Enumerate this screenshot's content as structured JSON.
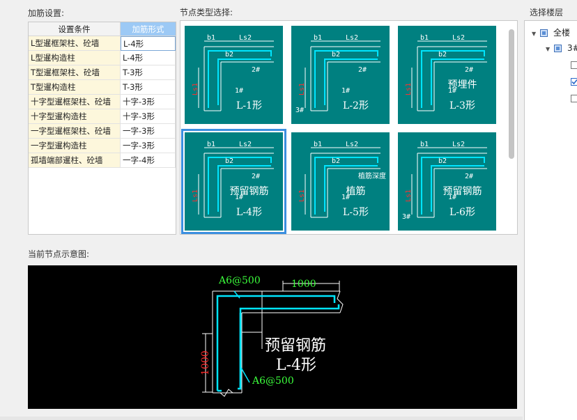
{
  "labels": {
    "rebar_settings": "加筋设置:",
    "node_type_select": "节点类型选择:",
    "current_node": "当前节点示意图:",
    "select_floor": "选择楼层"
  },
  "table": {
    "headers": [
      "设置条件",
      "加筋形式"
    ],
    "rows": [
      [
        "L型暹框架柱、砼墙",
        "L-4形"
      ],
      [
        "L型暹构造柱",
        "L-4形"
      ],
      [
        "T型暹框架柱、砼墙",
        "T-3形"
      ],
      [
        "T型暹构造柱",
        "T-3形"
      ],
      [
        "十字型暹框架柱、砼墙",
        "十字-3形"
      ],
      [
        "十字型暹构造柱",
        "十字-3形"
      ],
      [
        "一字型暹框架柱、砼墙",
        "一字-3形"
      ],
      [
        "一字型暹构造柱",
        "一字-3形"
      ],
      [
        "孤墙端部暹柱、砼墙",
        "一字-4形"
      ]
    ]
  },
  "tiles": [
    {
      "line1": "",
      "line2": "L-1形",
      "tags": {
        "b1": "b1",
        "ls2": "Ls2",
        "b2": "b2",
        "r2": "2#",
        "r1": "1#",
        "ls1": "Ls1",
        "r3": ""
      }
    },
    {
      "line1": "",
      "line2": "L-2形",
      "tags": {
        "b1": "b1",
        "ls2": "Ls2",
        "b2": "b2",
        "r2": "2#",
        "r1": "1#",
        "ls1": "Ls1",
        "r3": "3#"
      }
    },
    {
      "line1": "预埋件",
      "line2": "L-3形",
      "tags": {
        "b1": "b1",
        "ls2": "Ls2",
        "b2": "b2",
        "r2": "2#",
        "r1": "1#",
        "ls1": "Ls1",
        "r3": ""
      }
    },
    {
      "line1": "预留钢筋",
      "line2": "L-4形",
      "tags": {
        "b1": "b1",
        "ls2": "Ls2",
        "b2": "b2",
        "r2": "2#",
        "r1": "1#",
        "ls1": "Ls1",
        "r3": ""
      }
    },
    {
      "line1": "植筋",
      "line2": "L-5形",
      "tags": {
        "b1": "b1",
        "ls2": "Ls2",
        "b2": "b2",
        "r2": "植筋深度",
        "r1": "1#",
        "ls1": "Ls1",
        "r3": ""
      }
    },
    {
      "line1": "预留钢筋",
      "line2": "L-6形",
      "tags": {
        "b1": "b1",
        "ls2": "Ls2",
        "b2": "b2",
        "r2": "2#",
        "r1": "1#",
        "ls1": "Ls1",
        "r3": "3#"
      }
    }
  ],
  "preview": {
    "top_rebar": "A6@500",
    "bottom_rebar": "A6@500",
    "horiz_dim": "1000",
    "vert_dim": "1000",
    "title1": "预留钢筋",
    "title2": "L-4形"
  },
  "floors": [
    {
      "label": "全楼",
      "state": "partial",
      "expanded": true
    },
    {
      "label": "3#",
      "state": "partial",
      "expanded": true
    },
    {
      "label": "",
      "state": "unchecked"
    },
    {
      "label": "",
      "state": "checked"
    },
    {
      "label": "",
      "state": "unchecked"
    }
  ],
  "colors": {
    "tile_bg": "#008080",
    "selection": "#3b8fe0",
    "rebar": "#00e5ff",
    "dim_red": "#ff2a2a",
    "dim_green": "#3cff3c"
  }
}
